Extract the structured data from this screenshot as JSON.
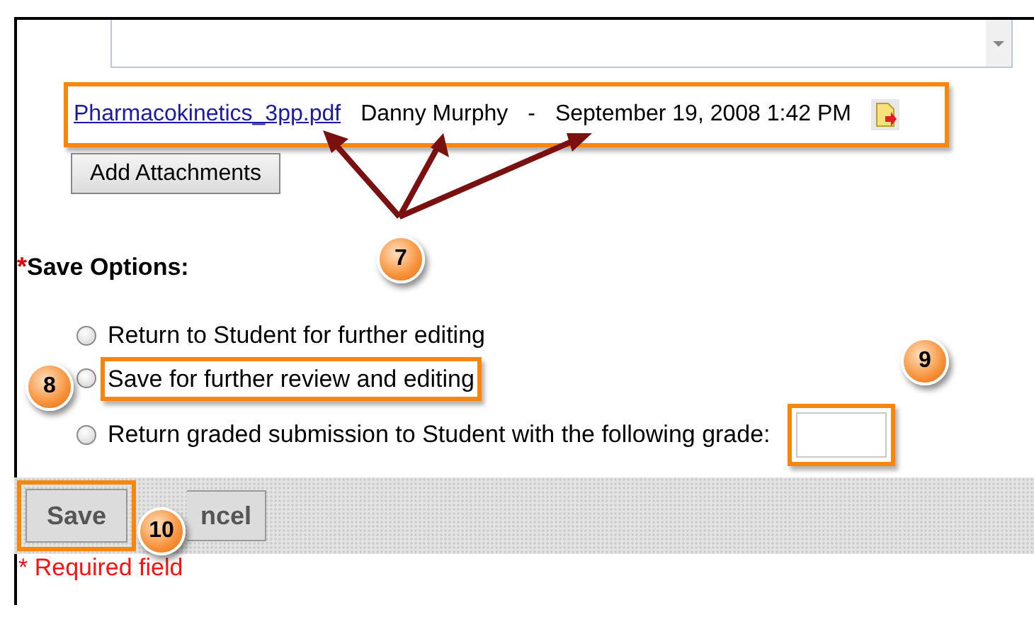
{
  "attachment": {
    "file": "Pharmacokinetics_3pp.pdf",
    "author": "Danny Murphy",
    "separator": "-",
    "date": "September 19, 2008 1:42 PM"
  },
  "add_button": "Add Attachments",
  "save_options": {
    "required_mark": "*",
    "label": "Save Options:",
    "options": [
      {
        "label": "Return to Student for further editing",
        "selected": false
      },
      {
        "label": "Save for further review and editing",
        "selected": false
      },
      {
        "label": "Return graded submission to Student with the following grade:",
        "selected": false
      }
    ]
  },
  "buttons": [
    "Save",
    "ncel"
  ],
  "required_note": "* Required field",
  "callouts": [
    "7",
    "8",
    "9",
    "10"
  ]
}
